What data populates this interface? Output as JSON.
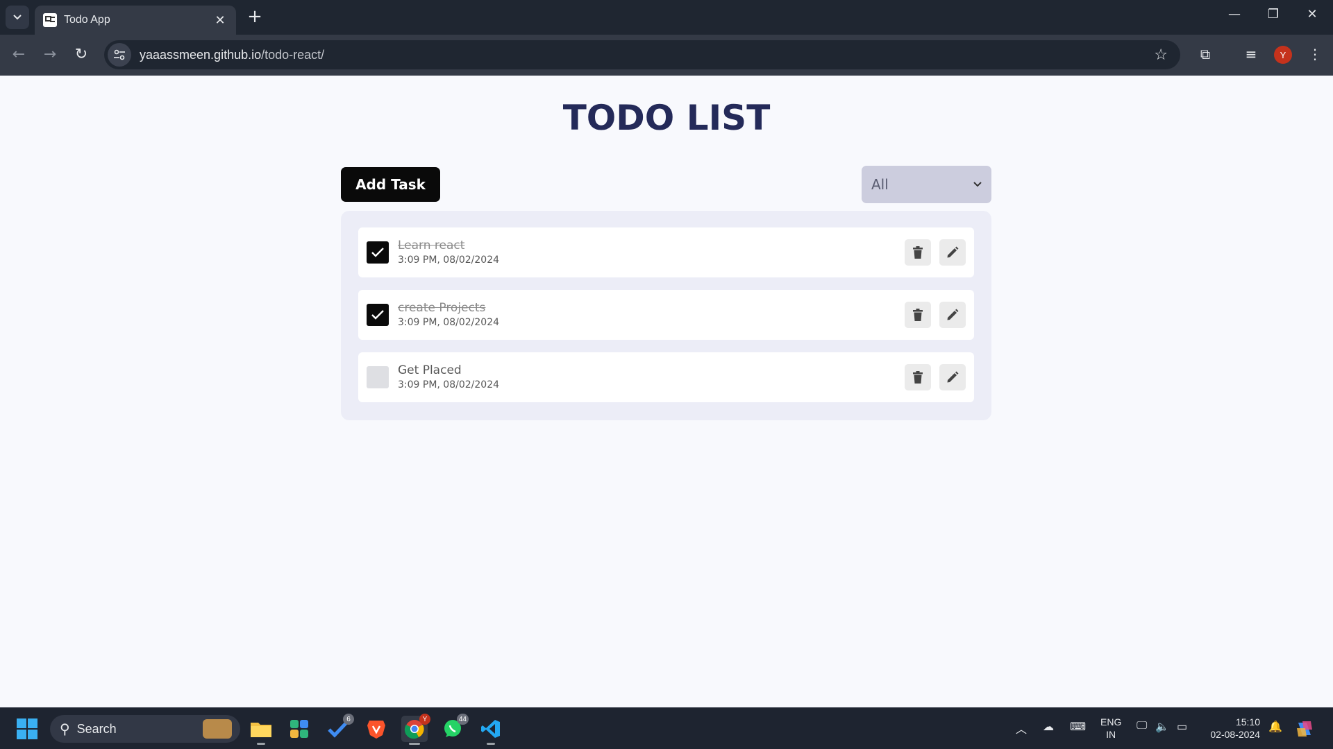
{
  "browser": {
    "tab_title": "Todo App",
    "url_host": "yaaassmeen.github.io",
    "url_path": "/todo-react/",
    "profile_initial": "Y"
  },
  "app": {
    "title": "TODO LIST",
    "add_button": "Add Task",
    "filter_value": "All",
    "filter_options": [
      "All"
    ],
    "todos": [
      {
        "title": "Learn react",
        "time": "3:09 PM, 08/02/2024",
        "completed": true
      },
      {
        "title": "create Projects",
        "time": "3:09 PM, 08/02/2024",
        "completed": true
      },
      {
        "title": "Get Placed",
        "time": "3:09 PM, 08/02/2024",
        "completed": false
      }
    ]
  },
  "taskbar": {
    "search_label": "Search",
    "badges": {
      "todo": "6",
      "whatsapp": "44",
      "chrome": "Y"
    },
    "lang_top": "ENG",
    "lang_bottom": "IN",
    "time": "15:10",
    "date": "02-08-2024"
  },
  "colors": {
    "title": "#242a59",
    "primary_button": "#0a0a0a",
    "filter_bg": "#cccdde",
    "list_bg": "#ecedf7",
    "page_bg": "#f8f9fd"
  }
}
